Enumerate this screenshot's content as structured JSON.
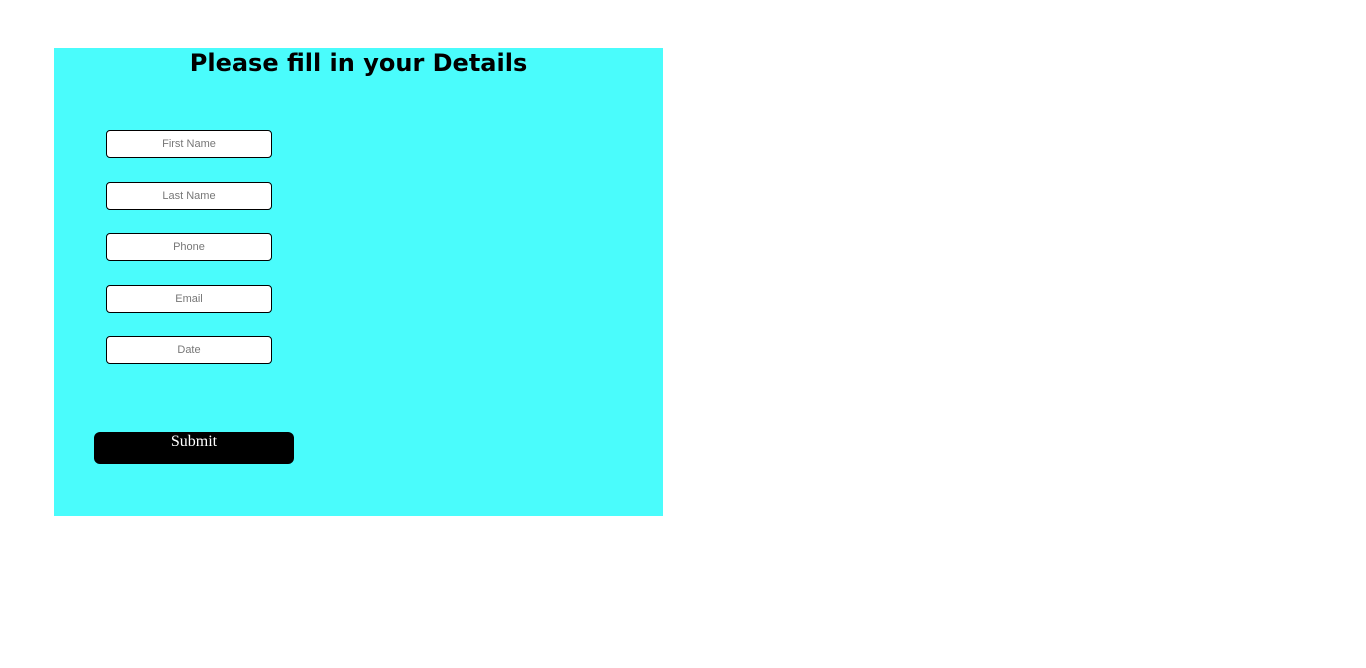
{
  "form": {
    "title": "Please fill in your Details",
    "fields": {
      "first_name": {
        "placeholder": "First Name",
        "value": ""
      },
      "last_name": {
        "placeholder": "Last Name",
        "value": ""
      },
      "phone": {
        "placeholder": "Phone",
        "value": ""
      },
      "email": {
        "placeholder": "Email",
        "value": ""
      },
      "date": {
        "placeholder": "Date",
        "value": ""
      }
    },
    "submit_label": "Submit"
  },
  "colors": {
    "panel_background": "#4afcfc",
    "button_background": "#000000",
    "button_text": "#ffffff"
  }
}
